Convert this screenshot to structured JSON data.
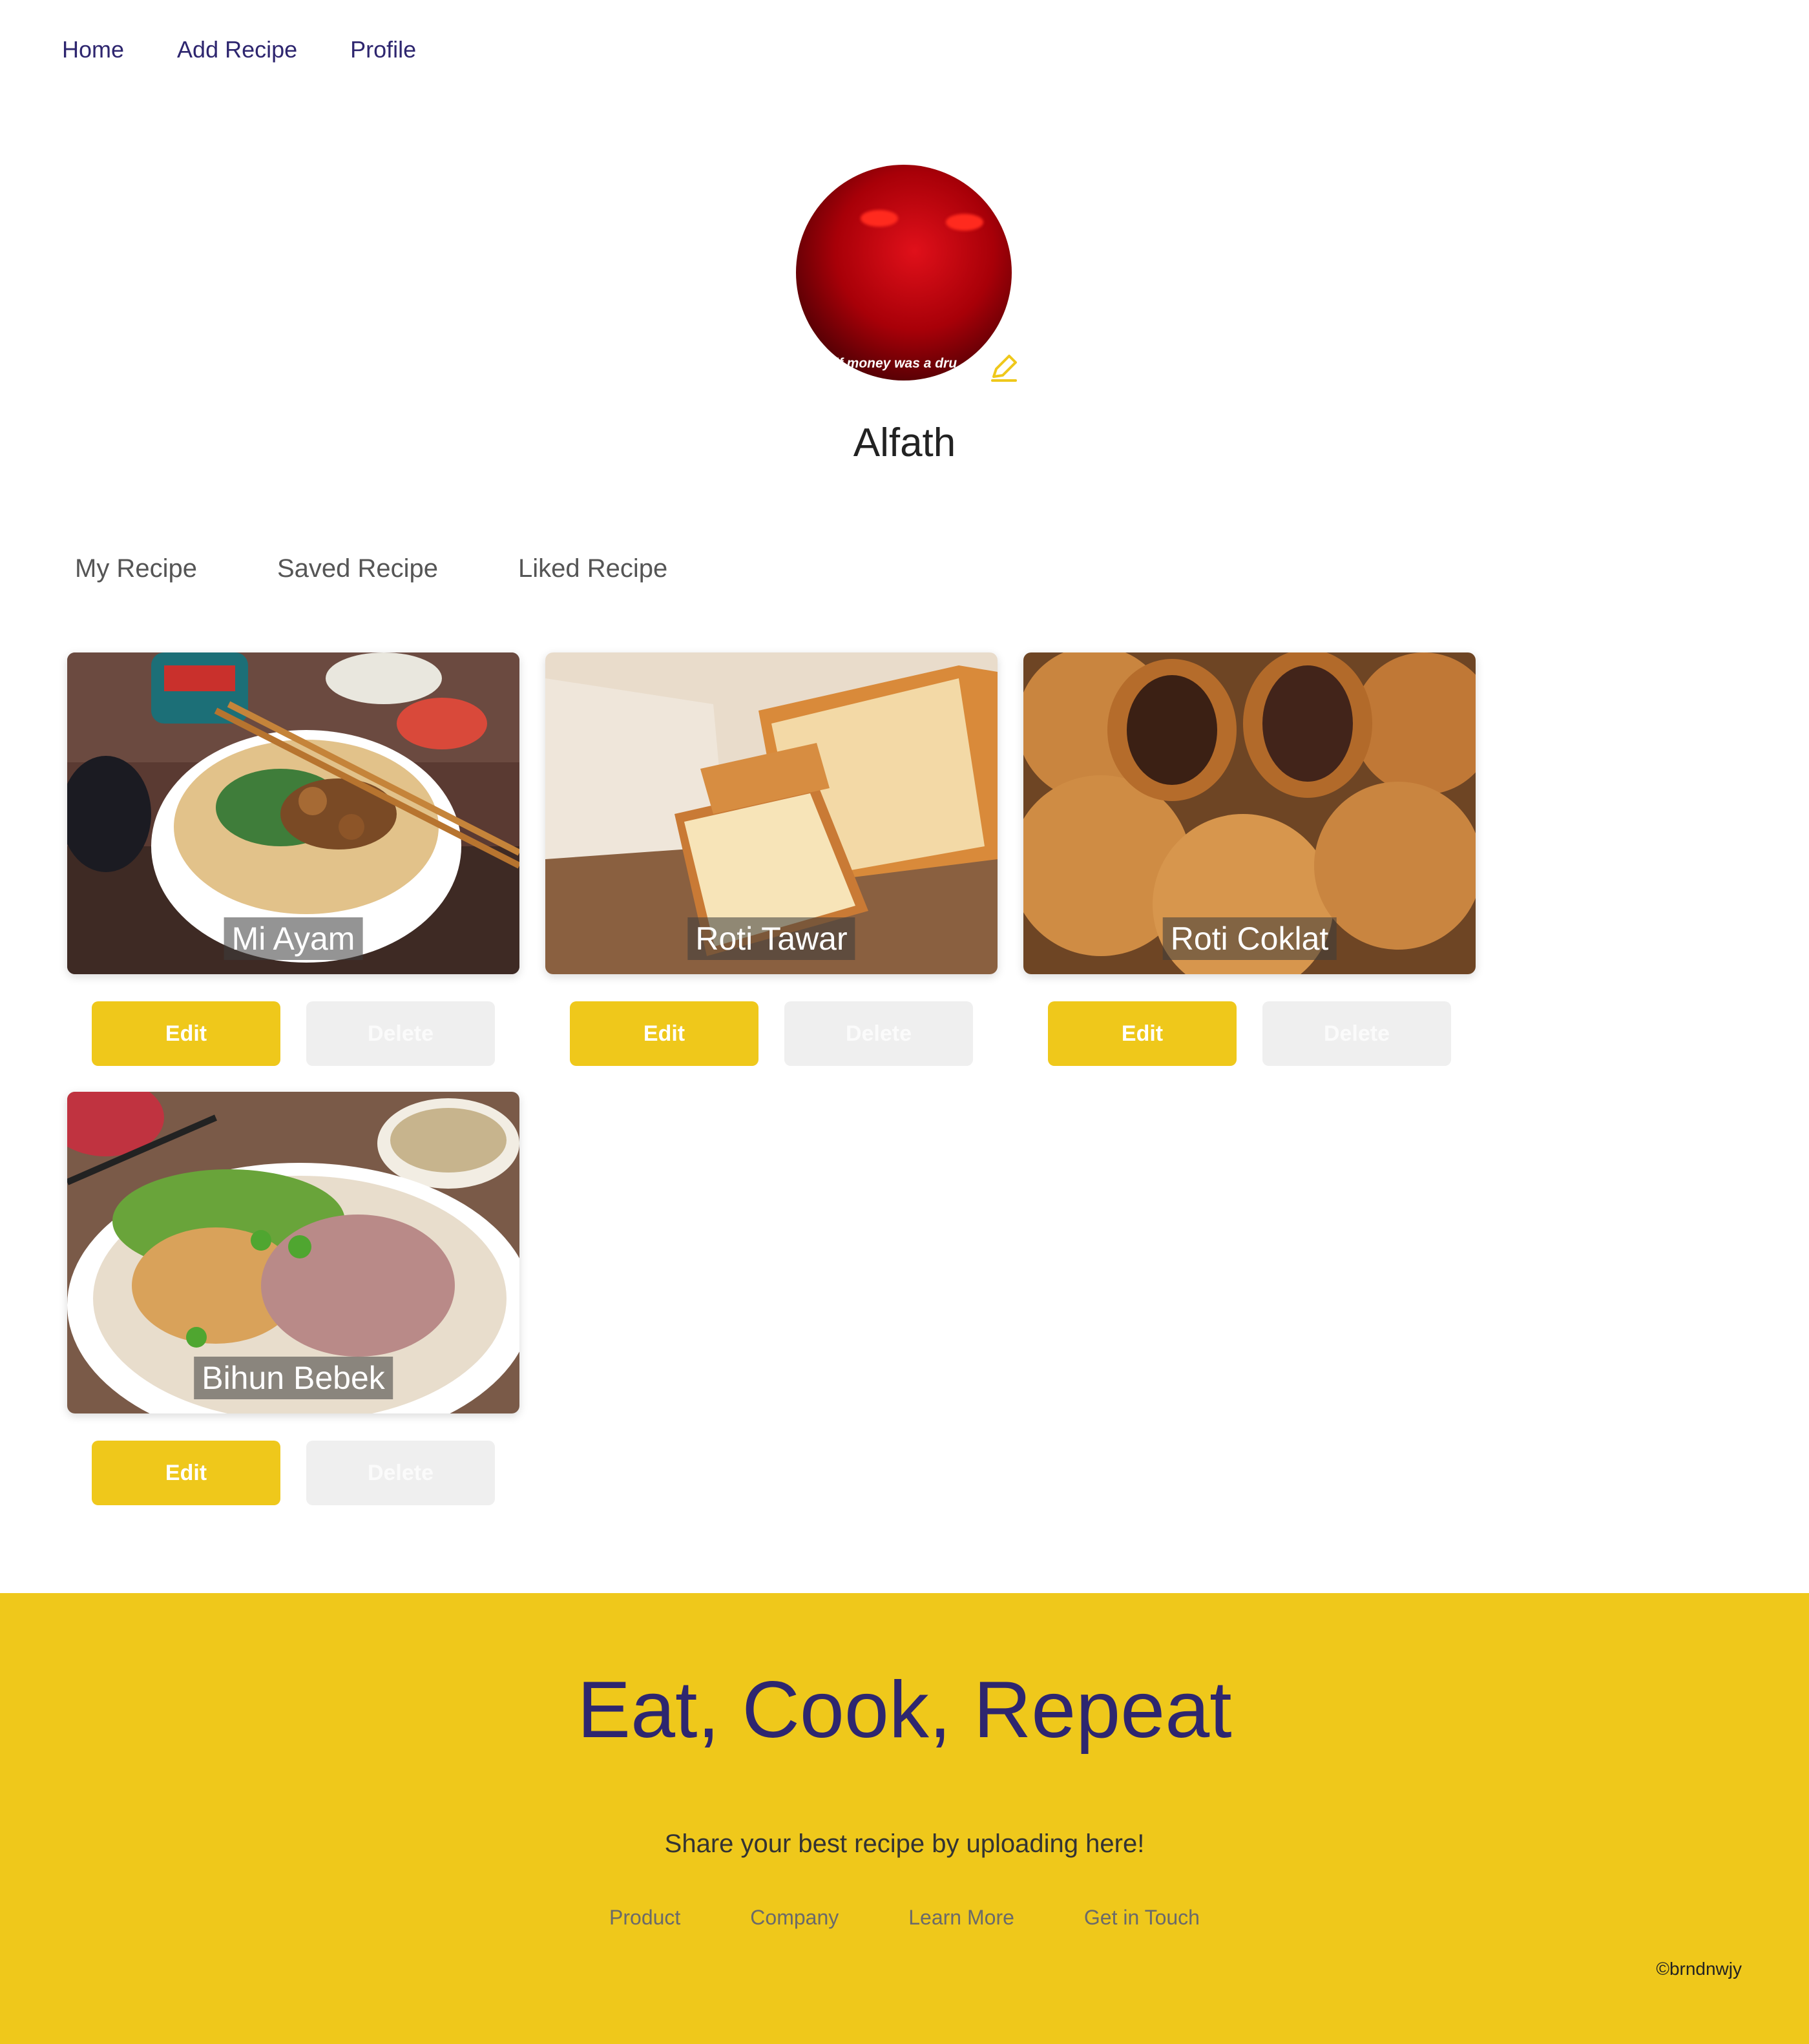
{
  "nav": {
    "home": "Home",
    "add_recipe": "Add Recipe",
    "profile": "Profile"
  },
  "profile": {
    "avatar_caption": "if money was a dru",
    "name": "Alfath"
  },
  "tabs": [
    "My Recipe",
    "Saved Recipe",
    "Liked Recipe"
  ],
  "recipes": [
    {
      "title": "Mi Ayam",
      "edit_label": "Edit",
      "delete_label": "Delete"
    },
    {
      "title": "Roti Tawar",
      "edit_label": "Edit",
      "delete_label": "Delete"
    },
    {
      "title": "Roti Coklat",
      "edit_label": "Edit",
      "delete_label": "Delete"
    },
    {
      "title": "Bihun Bebek",
      "edit_label": "Edit",
      "delete_label": "Delete"
    }
  ],
  "footer": {
    "tagline": "Eat, Cook, Repeat",
    "subline": "Share your best recipe by uploading here!",
    "links": [
      "Product",
      "Company",
      "Learn More",
      "Get in Touch"
    ],
    "copyright": "©brndnwjy"
  },
  "colors": {
    "accent": "#efc81b",
    "brand_text": "#2e266f",
    "delete_bg": "#efefef"
  }
}
